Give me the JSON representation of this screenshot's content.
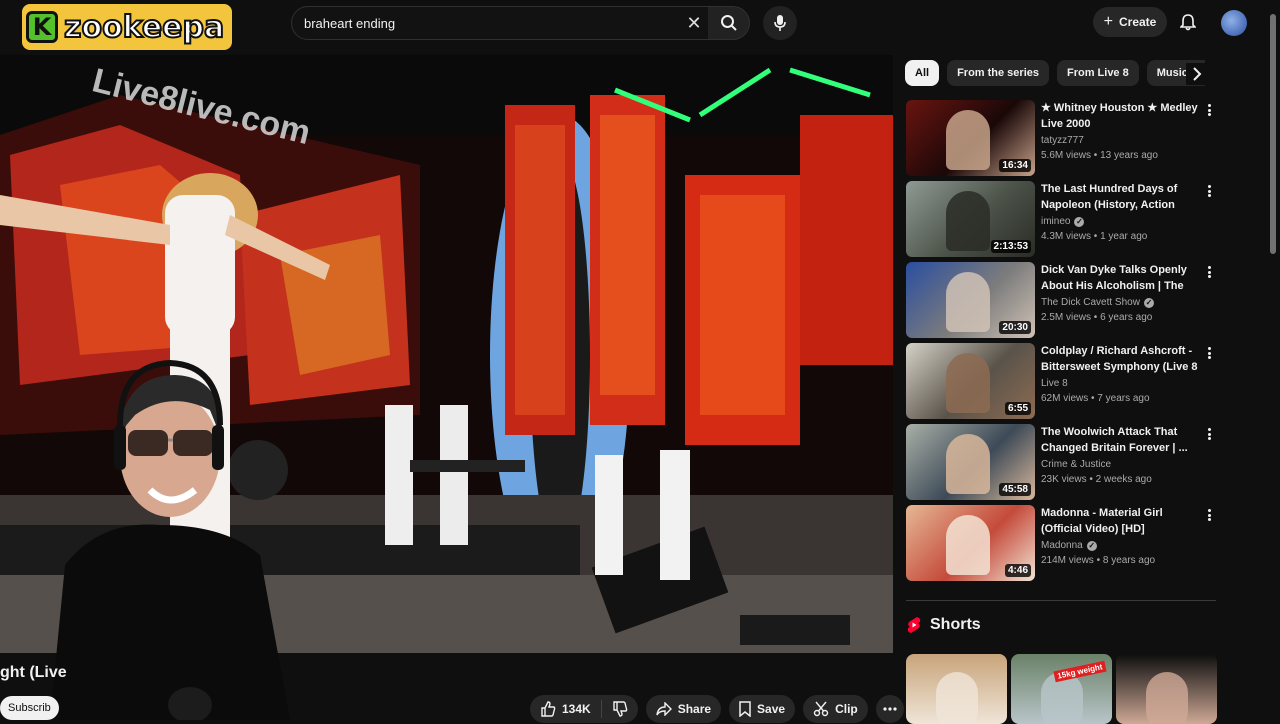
{
  "topbar": {
    "logo_letter": "K",
    "logo_text": "zookeepa",
    "search_value": "braheart ending",
    "create_label": "Create"
  },
  "player": {
    "overlay_text": "Live8live.com",
    "title_fragment": "ght (Live",
    "subscribe_fragment": "Subscrib"
  },
  "actions": {
    "likes": "134K",
    "share": "Share",
    "save": "Save",
    "clip": "Clip"
  },
  "chips": [
    "All",
    "From the series",
    "From Live 8",
    "Music fe"
  ],
  "recommendations": [
    {
      "title": "★ Whitney Houston ★ Medley Live 2000",
      "channel": "tatyzz777",
      "verified": false,
      "meta": "5.6M views • 13 years ago",
      "duration": "16:34",
      "thumb_colors": [
        "#6a1410",
        "#1a0808",
        "#c7a38a"
      ]
    },
    {
      "title": "The Last Hundred Days of Napoleon (History, Action film...",
      "channel": "imineo",
      "verified": true,
      "meta": "4.3M views • 1 year ago",
      "duration": "2:13:53",
      "thumb_colors": [
        "#8f9a94",
        "#4b5248",
        "#2a2c26"
      ]
    },
    {
      "title": "Dick Van Dyke Talks Openly About His Alcoholism | The Di...",
      "channel": "The Dick Cavett Show",
      "verified": true,
      "meta": "2.5M views • 6 years ago",
      "duration": "20:30",
      "thumb_colors": [
        "#2a4ea0",
        "#7c7c7c",
        "#d0c2b6"
      ]
    },
    {
      "title": "Coldplay / Richard Ashcroft - Bittersweet Symphony (Live 8 ...",
      "channel": "Live 8",
      "verified": false,
      "meta": "62M views • 7 years ago",
      "duration": "6:55",
      "thumb_colors": [
        "#d5d2c8",
        "#5a534a",
        "#8d6b52"
      ]
    },
    {
      "title": "The Woolwich Attack That Changed Britain Forever | ...",
      "channel": "Crime & Justice",
      "verified": false,
      "meta": "23K views • 2 weeks ago",
      "duration": "45:58",
      "thumb_colors": [
        "#a9b0a7",
        "#3d4a57",
        "#d8b79b"
      ]
    },
    {
      "title": "Madonna - Material Girl (Official Video) [HD]",
      "channel": "Madonna",
      "verified": true,
      "meta": "214M views • 8 years ago",
      "duration": "4:46",
      "thumb_colors": [
        "#e6b896",
        "#c44a3a",
        "#f3e3d4"
      ]
    }
  ],
  "shorts": {
    "heading": "Shorts",
    "items": [
      {
        "colors": [
          "#c8a47a",
          "#efe5d8"
        ],
        "badge": ""
      },
      {
        "colors": [
          "#6a8268",
          "#b9c5c9"
        ],
        "badge": "15kg weight"
      },
      {
        "colors": [
          "#0e0e0e",
          "#cfa996"
        ],
        "badge": ""
      }
    ]
  },
  "colors": {
    "accent_red": "#ff0033",
    "logo_yellow": "#f2c53d",
    "logo_green": "#53c12b"
  }
}
